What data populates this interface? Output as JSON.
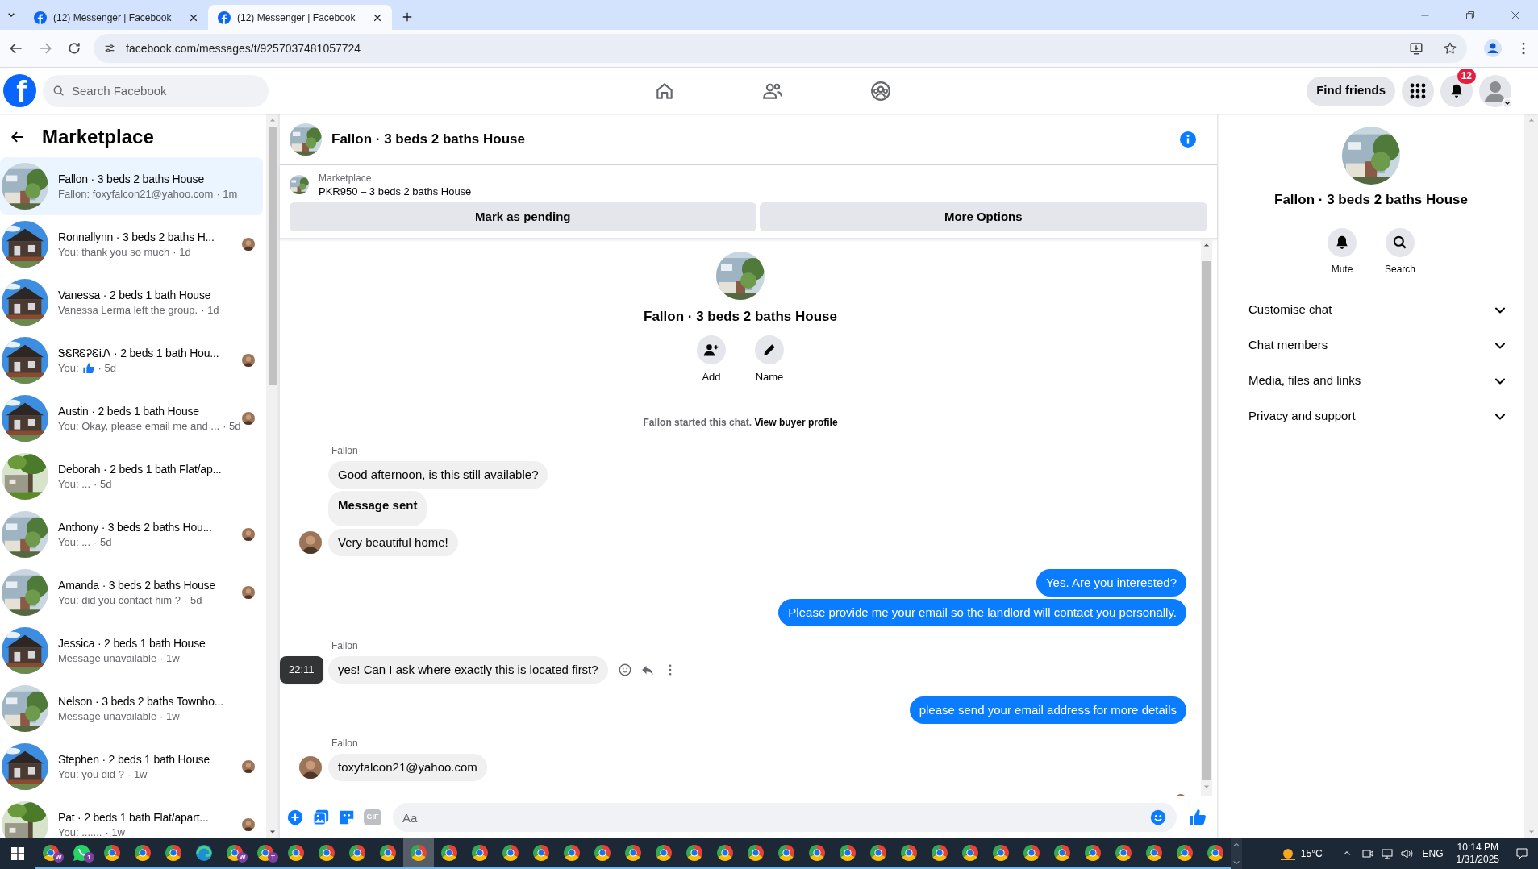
{
  "browser": {
    "tabs": [
      {
        "title": "(12) Messenger | Facebook",
        "selected": false
      },
      {
        "title": "(12) Messenger | Facebook",
        "selected": true
      }
    ],
    "url": "facebook.com/messages/t/9257037481057724"
  },
  "facebook_nav": {
    "logo": "f",
    "search": {
      "placeholder": "Search Facebook"
    },
    "nav_icons": [
      {
        "kind": "home"
      },
      {
        "kind": "friends"
      },
      {
        "kind": "groups"
      }
    ],
    "find_friends": "Find friends",
    "notification_count": "12"
  },
  "sidebar": {
    "title": "Marketplace",
    "conversations": [
      {
        "name": "Fallon · 3 beds 2 baths House",
        "preview": "Fallon: foxyfalcon21@yahoo.com",
        "time": "· 1m",
        "selected": true,
        "read_receipt": false
      },
      {
        "name": "Ronnallynn · 3 beds 2 baths H...",
        "preview": "You: thank you so much",
        "time": "· 1d",
        "selected": false,
        "read_receipt": true
      },
      {
        "name": "Vanessa · 2 beds 1 bath House",
        "preview": "Vanessa Lerma left the group.",
        "time": "· 1d",
        "selected": false,
        "read_receipt": false
      },
      {
        "name": "ᏕᏋᏒᏋᎮᏋᎥᏁ · 2 beds 1 bath Hou...",
        "preview": "You:",
        "like": true,
        "time": "· 5d",
        "selected": false,
        "read_receipt": true
      },
      {
        "name": "Austin · 2 beds 1 bath House",
        "preview": "You: Okay, please email me and ...",
        "time": "· 5d",
        "selected": false,
        "read_receipt": true
      },
      {
        "name": "Deborah · 2 beds 1 bath Flat/ap...",
        "preview": "You: ...",
        "time": "· 5d",
        "selected": false,
        "read_receipt": false
      },
      {
        "name": "Anthony · 3 beds 2 baths Hou...",
        "preview": "You: ...",
        "time": "· 5d",
        "selected": false,
        "read_receipt": true
      },
      {
        "name": "Amanda · 3 beds 2 baths House",
        "preview": "You: did you contact him ?",
        "time": "· 5d",
        "selected": false,
        "read_receipt": true
      },
      {
        "name": "Jessica · 2 beds 1 bath House",
        "preview": "Message unavailable",
        "time": "· 1w",
        "selected": false,
        "read_receipt": false
      },
      {
        "name": "Nelson · 3 beds 2 baths Townho...",
        "preview": "Message unavailable",
        "time": "· 1w",
        "selected": false,
        "read_receipt": false
      },
      {
        "name": "Stephen · 2 beds 1 bath House",
        "preview": "You: you did ?",
        "time": "· 1w",
        "selected": false,
        "read_receipt": true
      },
      {
        "name": "Pat · 2 beds 1 bath Flat/apart...",
        "preview": "You: .......",
        "time": "· 1w",
        "selected": false,
        "read_receipt": true
      }
    ]
  },
  "chat": {
    "header": {
      "title": "Fallon · 3 beds 2 baths House"
    },
    "listing": {
      "label": "Marketplace",
      "item": "PKR950 – 3 beds 2 baths House",
      "actions": [
        "Mark as pending",
        "More Options"
      ]
    },
    "intro": {
      "title": "Fallon · 3 beds 2 baths House",
      "actions": [
        {
          "kind": "add",
          "label": "Add"
        },
        {
          "kind": "name",
          "label": "Name"
        }
      ],
      "note": "Fallon started this chat.",
      "link": "View buyer profile"
    },
    "messages": [
      {
        "kind": "sender",
        "text": "Fallon"
      },
      {
        "kind": "incoming",
        "text": "Good afternoon, is this still available?",
        "avatar": false
      },
      {
        "kind": "incoming",
        "text": "Message sent",
        "avatar": false,
        "bold": true
      },
      {
        "kind": "incoming",
        "text": "Very beautiful home!",
        "avatar": true
      },
      {
        "kind": "outgoing",
        "text": "Yes. Are you interested?"
      },
      {
        "kind": "outgoing",
        "text": "Please provide me your email so the landlord will contact you personally."
      },
      {
        "kind": "sender",
        "text": "Fallon"
      },
      {
        "kind": "incoming",
        "text": "yes! Can I ask where exactly this is located first?",
        "avatar": false,
        "time_tooltip": "22:11",
        "hovered": true
      },
      {
        "kind": "outgoing",
        "text": "please send your email address for more details"
      },
      {
        "kind": "sender",
        "text": "Fallon"
      },
      {
        "kind": "incoming",
        "text": "foxyfalcon21@yahoo.com",
        "avatar": true
      }
    ],
    "read_receipt": true,
    "composer": {
      "gif_label": "GIF",
      "placeholder": "Aa"
    }
  },
  "details": {
    "title": "Fallon · 3 beds 2 baths House",
    "actions": [
      {
        "kind": "mute",
        "label": "Mute"
      },
      {
        "kind": "search",
        "label": "Search"
      }
    ],
    "sections": [
      {
        "label": "Customise chat",
        "expanded": false
      },
      {
        "label": "Chat members",
        "expanded": false
      },
      {
        "label": "Media, files and links",
        "expanded": false
      },
      {
        "label": "Privacy and support",
        "expanded": false
      }
    ]
  },
  "taskbar": {
    "apps": [
      {
        "kind": "chrome",
        "badge": "W",
        "selected": false
      },
      {
        "kind": "whatsapp",
        "badge": "1",
        "selected": false
      },
      {
        "kind": "chrome",
        "selected": false
      },
      {
        "kind": "chrome",
        "selected": false
      },
      {
        "kind": "chrome",
        "selected": false
      },
      {
        "kind": "edge",
        "selected": false
      },
      {
        "kind": "chrome",
        "badge": "W",
        "selected": false
      },
      {
        "kind": "chrome",
        "badge": "T",
        "selected": false
      },
      {
        "kind": "chrome",
        "selected": false
      },
      {
        "kind": "chrome",
        "selected": false
      },
      {
        "kind": "chrome",
        "selected": false
      },
      {
        "kind": "chrome",
        "selected": false
      },
      {
        "kind": "chrome",
        "selected": true
      },
      {
        "kind": "chrome",
        "selected": false
      },
      {
        "kind": "chrome",
        "selected": false
      },
      {
        "kind": "chrome",
        "selected": false
      },
      {
        "kind": "chrome",
        "selected": false
      },
      {
        "kind": "chrome",
        "selected": false
      },
      {
        "kind": "chrome",
        "selected": false
      },
      {
        "kind": "chrome",
        "selected": false
      },
      {
        "kind": "chrome",
        "selected": false
      },
      {
        "kind": "chrome",
        "selected": false
      },
      {
        "kind": "chrome",
        "selected": false
      },
      {
        "kind": "chrome",
        "selected": false
      },
      {
        "kind": "chrome",
        "selected": false
      },
      {
        "kind": "chrome",
        "selected": false
      },
      {
        "kind": "chrome",
        "selected": false
      },
      {
        "kind": "chrome",
        "selected": false
      },
      {
        "kind": "chrome",
        "selected": false
      },
      {
        "kind": "chrome",
        "selected": false
      },
      {
        "kind": "chrome",
        "selected": false
      },
      {
        "kind": "chrome",
        "selected": false
      },
      {
        "kind": "chrome",
        "selected": false
      },
      {
        "kind": "chrome",
        "selected": false
      },
      {
        "kind": "chrome",
        "selected": false
      },
      {
        "kind": "chrome",
        "selected": false
      },
      {
        "kind": "chrome",
        "selected": false
      },
      {
        "kind": "chrome",
        "selected": false
      },
      {
        "kind": "chrome",
        "selected": false
      }
    ],
    "weather": "15°C",
    "language": "ENG",
    "time": "10:14 PM",
    "date": "1/31/2025"
  }
}
